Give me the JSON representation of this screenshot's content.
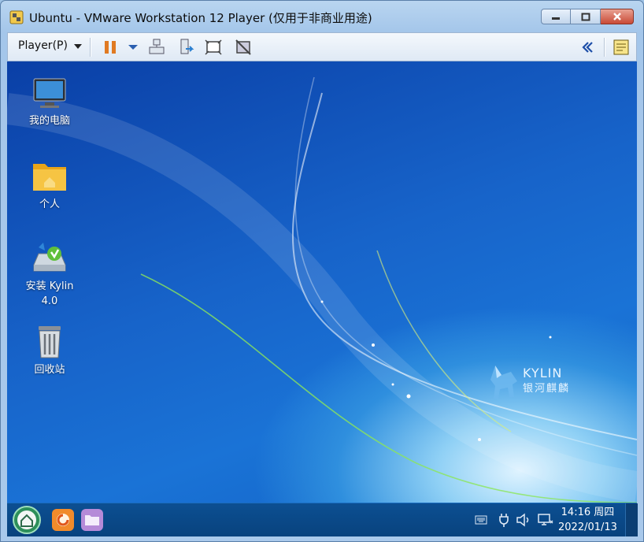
{
  "window": {
    "title": "Ubuntu - VMware Workstation 12 Player (仅用于非商业用途)"
  },
  "toolbar": {
    "player_menu": "Player(P)"
  },
  "desktop": {
    "icons": [
      {
        "label": "我的电脑"
      },
      {
        "label": "个人"
      },
      {
        "label": "安装 Kylin 4.0"
      },
      {
        "label": "回收站"
      }
    ],
    "logo": {
      "brand": "KYLIN",
      "brand_cn": "银河麒麟"
    }
  },
  "taskbar": {
    "time": "14:16 周四",
    "date": "2022/01/13"
  }
}
